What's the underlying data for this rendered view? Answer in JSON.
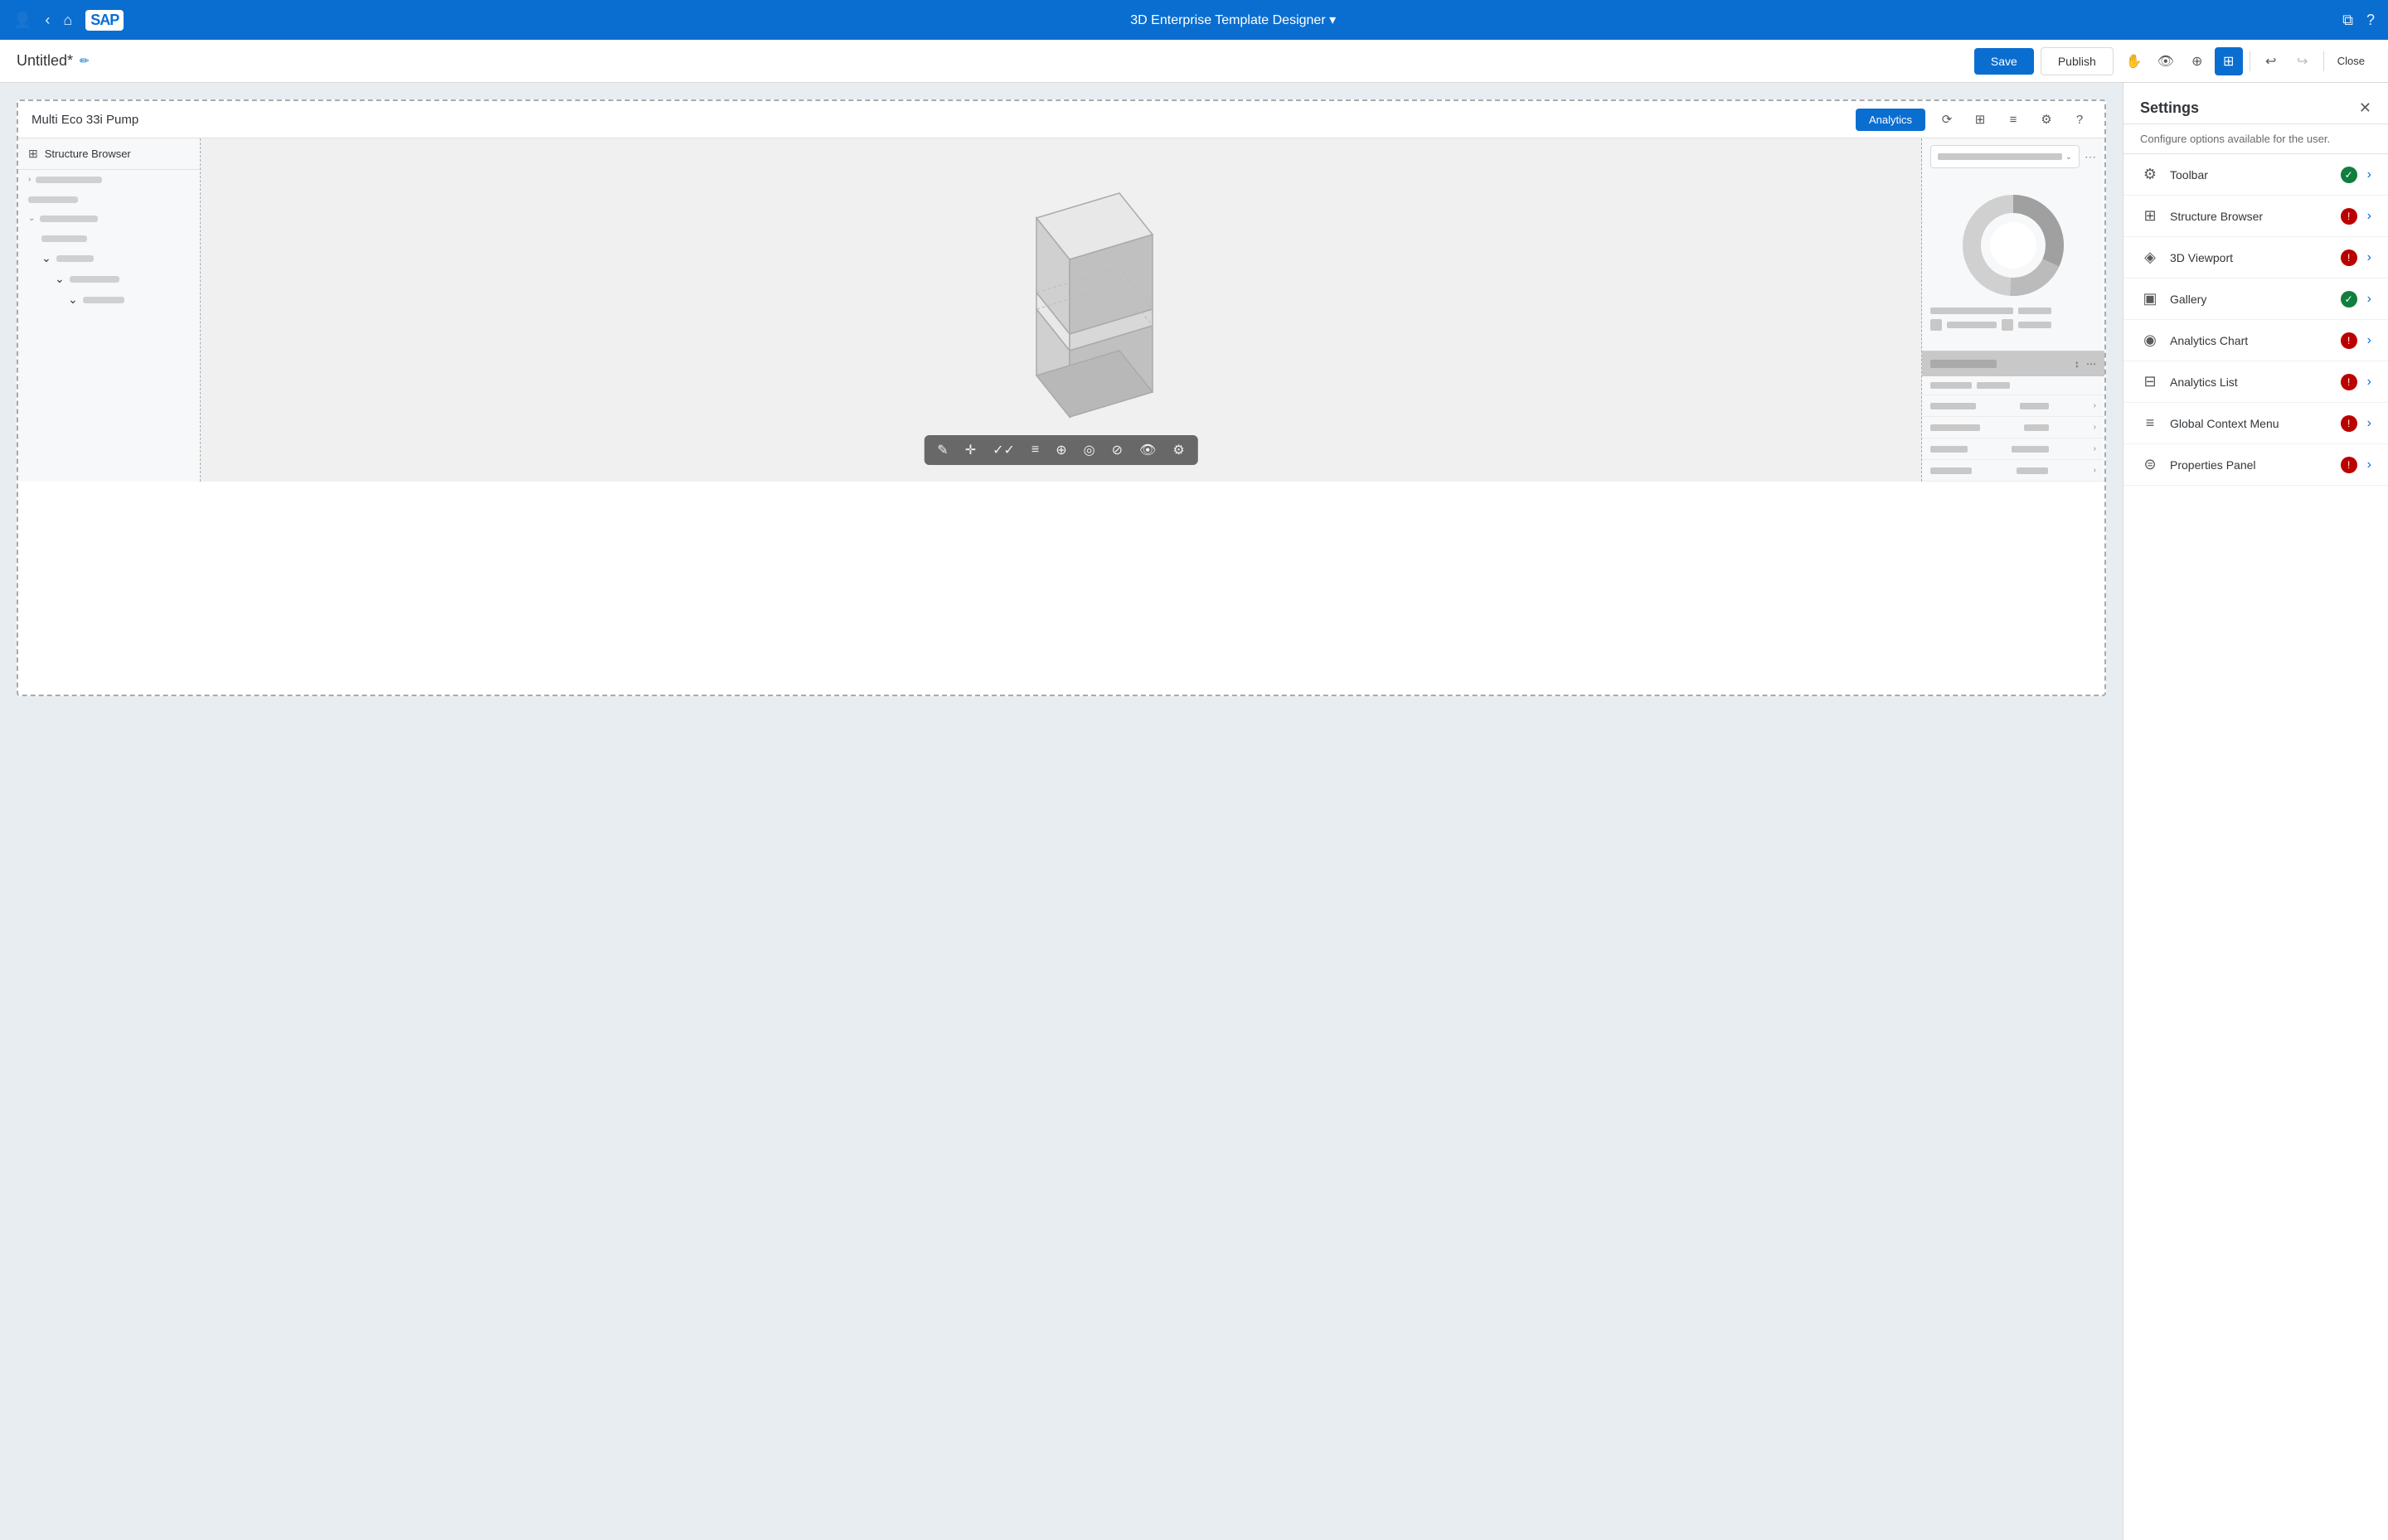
{
  "topNav": {
    "title": "3D Enterprise Template Designer ▾",
    "icons": [
      "user",
      "back",
      "home"
    ]
  },
  "toolbar": {
    "docTitle": "Untitled*",
    "saveLabel": "Save",
    "publishLabel": "Publish",
    "closeLabel": "Close"
  },
  "template": {
    "title": "Multi Eco 33i Pump",
    "analyticsBtn": "Analytics"
  },
  "structurePanel": {
    "title": "Structure Browser"
  },
  "settings": {
    "title": "Settings",
    "subtitle": "Configure options available for the user.",
    "items": [
      {
        "label": "Toolbar",
        "status": "green",
        "icon": "⚙"
      },
      {
        "label": "Structure Browser",
        "status": "red",
        "icon": "⊞"
      },
      {
        "label": "3D Viewport",
        "status": "red",
        "icon": "◈"
      },
      {
        "label": "Gallery",
        "status": "green",
        "icon": "▣"
      },
      {
        "label": "Analytics Chart",
        "status": "red",
        "icon": "◉"
      },
      {
        "label": "Analytics List",
        "status": "red",
        "icon": "⊟"
      },
      {
        "label": "Global Context Menu",
        "status": "red",
        "icon": "≡"
      },
      {
        "label": "Properties Panel",
        "status": "red",
        "icon": "⊜"
      }
    ]
  }
}
